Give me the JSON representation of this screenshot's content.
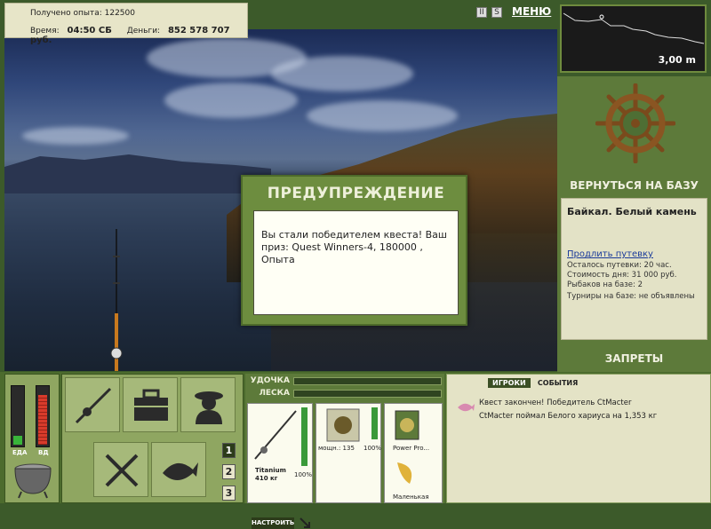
{
  "header": {
    "exp_label": "Получено опыта:",
    "exp_value": "122500",
    "time_label": "Время:",
    "time_value": "04:50 СБ",
    "money_label": "Деньги:",
    "money_value": "852 578 707 руб."
  },
  "top_controls": {
    "pause": "II",
    "sound": "S",
    "menu": "МЕНЮ"
  },
  "depth": {
    "value": "3,00 m"
  },
  "right_panel": {
    "back_to_base": "ВЕРНУТЬСЯ НА БАЗУ",
    "base_name": "Байкал. Белый камень",
    "extend_pass": "Продлить путевку",
    "remaining": "Осталось путевки: 20 час.",
    "day_cost": "Стоимость дня: 31 000 руб.",
    "fishers": "Рыбаков на базе: 2",
    "tournaments": "Турниры на базе: не объявлены",
    "bans": "ЗАПРЕТЫ"
  },
  "dialog": {
    "title": "ПРЕДУПРЕЖДЕНИЕ",
    "message": "Вы стали победителем квеста! Ваш приз: Quest Winners-4, 180000 , Опыта"
  },
  "meters": {
    "food_label": "ЕДА",
    "vodka_label": "ВД",
    "food_level": 0.15,
    "vodka_level": 0.85
  },
  "quick_slots": [
    "1",
    "2",
    "3"
  ],
  "tackle": {
    "rod_label": "УДОЧКА",
    "line_label": "ЛЕСКА",
    "rod_name": "Titanium",
    "rod_weight": "410 кг",
    "rod_percent": "100%",
    "reel_name": "мощн.: 135",
    "reel_percent": "100%",
    "line_name": "Power Pro...",
    "bait_name": "Маленькая",
    "adjust_button": "НАСТРОИТЬ"
  },
  "chat": {
    "tabs": [
      "ИГРОКИ",
      "СОБЫТИЯ"
    ],
    "messages": [
      "Квест закончен! Победитель CtMacter",
      "CtMacter поймал Белого хариуса на 1,353 кг"
    ]
  }
}
